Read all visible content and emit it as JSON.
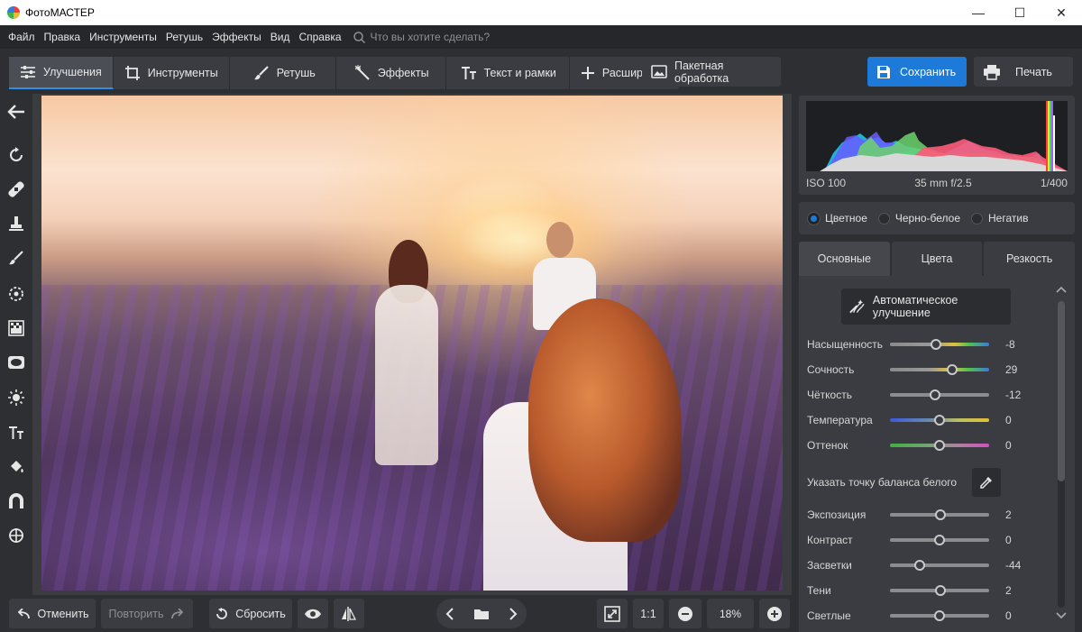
{
  "app": {
    "title": "ФотоМАСТЕР"
  },
  "window_controls": {
    "minimize": "—",
    "maximize": "☐",
    "close": "✕"
  },
  "menu": {
    "items": [
      "Файл",
      "Правка",
      "Инструменты",
      "Ретушь",
      "Эффекты",
      "Вид",
      "Справка"
    ],
    "search_placeholder": "Что вы хотите сделать?"
  },
  "toolbar": {
    "tabs": [
      {
        "label": "Улучшения",
        "icon": "sliders-icon",
        "active": true
      },
      {
        "label": "Инструменты",
        "icon": "crop-icon",
        "active": false
      },
      {
        "label": "Ретушь",
        "icon": "brush-icon",
        "active": false
      },
      {
        "label": "Эффекты",
        "icon": "magic-wand-icon",
        "active": false
      },
      {
        "label": "Текст и рамки",
        "icon": "text-icon",
        "active": false
      },
      {
        "label": "Расширения",
        "icon": "plus-icon",
        "active": false
      }
    ],
    "batch_label": "Пакетная обработка",
    "save_label": "Сохранить",
    "print_label": "Печать"
  },
  "left_tools": [
    "back-arrow-icon",
    "rotate-icon",
    "bandage-icon",
    "stamp-icon",
    "brush-icon",
    "target-icon",
    "gradient-icon",
    "vignette-icon",
    "sun-icon",
    "text-icon",
    "fill-bucket-icon",
    "magnet-icon",
    "crosshair-icon"
  ],
  "bottom": {
    "undo_label": "Отменить",
    "redo_label": "Повторить",
    "reset_label": "Сбросить",
    "ratio_label": "1:1",
    "zoom_value": "18%"
  },
  "histogram": {
    "iso": "ISO 100",
    "lens": "35 mm f/2.5",
    "shutter": "1/400"
  },
  "modes": [
    {
      "label": "Цветное",
      "selected": true
    },
    {
      "label": "Черно-белое",
      "selected": false
    },
    {
      "label": "Негатив",
      "selected": false
    }
  ],
  "subtabs": [
    {
      "label": "Основные",
      "active": true
    },
    {
      "label": "Цвета",
      "active": false
    },
    {
      "label": "Резкость",
      "active": false
    }
  ],
  "auto_label": "Автоматическое улучшение",
  "sliders_top": [
    {
      "label": "Насыщенность",
      "value": "-8",
      "level": 0.46,
      "track": "saturation"
    },
    {
      "label": "Сочность",
      "value": "29",
      "level": 0.63,
      "track": "vibrance"
    },
    {
      "label": "Чёткость",
      "value": "-12",
      "level": 0.45,
      "track": "gray"
    },
    {
      "label": "Температура",
      "value": "0",
      "level": 0.5,
      "track": "temperature"
    },
    {
      "label": "Оттенок",
      "value": "0",
      "level": 0.5,
      "track": "tint"
    }
  ],
  "white_balance_label": "Указать точку баланса белого",
  "sliders_bottom": [
    {
      "label": "Экспозиция",
      "value": "2",
      "level": 0.51
    },
    {
      "label": "Контраст",
      "value": "0",
      "level": 0.5
    },
    {
      "label": "Засветки",
      "value": "-44",
      "level": 0.3
    },
    {
      "label": "Тени",
      "value": "2",
      "level": 0.51
    },
    {
      "label": "Светлые",
      "value": "0",
      "level": 0.5
    }
  ],
  "colors": {
    "accent": "#1e7ad8",
    "panel": "#3a3c41",
    "background": "#2d2f33"
  }
}
